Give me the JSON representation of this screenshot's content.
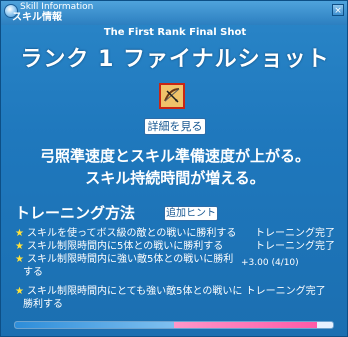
{
  "window": {
    "title_en": "Skill Information",
    "title_jp": "スキル情報",
    "close_label": "×"
  },
  "skill": {
    "name_en": "The First Rank Final Shot",
    "name_jp": "ランク 1 ファイナルショット",
    "icon": "bow-arrow-icon",
    "detail_button": "詳細を見る",
    "description_line1": "弓照準速度とスキル準備速度が上がる。",
    "description_line2": "スキル持続時間が増える。"
  },
  "training": {
    "title": "トレーニング方法",
    "hint_button": "追加ヒント",
    "rows": [
      {
        "text": "スキルを使ってボス級の敵との戦いに勝利する",
        "status": "トレーニング完了"
      },
      {
        "text": "スキル制限時間内に5体との戦いに勝利する",
        "status": "トレーニング完了"
      },
      {
        "text": "スキル制限時間内に強い敵5体との戦いに勝利",
        "status": ""
      },
      {
        "text": "する",
        "status": ""
      },
      {
        "text": "スキル制限時間内にとても強い敵5体との戦いに トレーニング完了",
        "status": ""
      },
      {
        "text": "勝利する",
        "status": ""
      }
    ],
    "progress_note": "+3.00 (4/10)"
  },
  "experience": {
    "fill_fraction": 0.5,
    "pink_fraction": 0.45
  }
}
